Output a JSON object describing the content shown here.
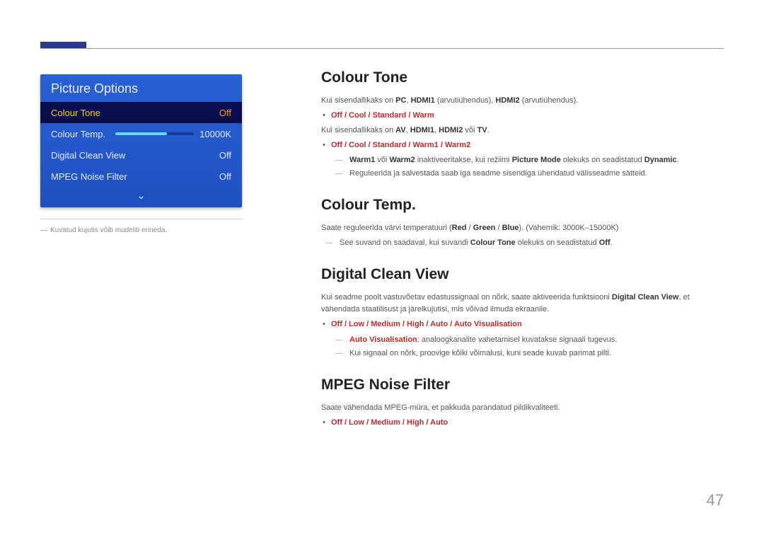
{
  "page_number": "47",
  "osd": {
    "title": "Picture Options",
    "rows": [
      {
        "label": "Colour Tone",
        "value": "Off"
      },
      {
        "label": "Colour Temp.",
        "value": "10000K"
      },
      {
        "label": "Digital Clean View",
        "value": "Off"
      },
      {
        "label": "MPEG Noise Filter",
        "value": "Off"
      }
    ],
    "chevron": "⌄"
  },
  "left_note": "Kuvatud kujutis võib mudeliti erineda.",
  "s1": {
    "h": "Colour Tone",
    "p1a": "Kui sisendallikaks on ",
    "p1b": "PC",
    "p1c": ", ",
    "p1d": "HDMI1",
    "p1e": " (arvutiühendus), ",
    "p1f": "HDMI2",
    "p1g": " (arvutiühendus).",
    "b1": "Off / Cool / Standard / Warm",
    "p2a": "Kui sisendallikaks on ",
    "p2b": "AV",
    "p2c": ", ",
    "p2d": "HDMI1",
    "p2e": ", ",
    "p2f": "HDMI2",
    "p2g": " või ",
    "p2h": "TV",
    "p2i": ".",
    "b2": "Off / Cool / Standard / Warm1 / Warm2",
    "n1a": "Warm1",
    "n1b": " või ",
    "n1c": "Warm2",
    "n1d": " inaktiveeritakse, kui režiimi ",
    "n1e": "Picture Mode",
    "n1f": " olekuks on seadistatud ",
    "n1g": "Dynamic",
    "n1h": ".",
    "n2": "Reguleerida ja salvestada saab iga seadme sisendiga ühendatud välisseadme sätteid."
  },
  "s2": {
    "h": "Colour Temp.",
    "p1a": "Saate reguleerida värvi temperatuuri (",
    "p1b": "Red",
    "p1c": " / ",
    "p1d": "Green",
    "p1e": " / ",
    "p1f": "Blue",
    "p1g": "). (Vahemik: 3000K–15000K)",
    "n1a": "See suvand on saadaval, kui suvandi ",
    "n1b": "Colour Tone",
    "n1c": " olekuks on seadistatud ",
    "n1d": "Off",
    "n1e": "."
  },
  "s3": {
    "h": "Digital Clean View",
    "p1a": "Kui seadme poolt vastuvõetav edastussignaal on nõrk, saate aktiveerida funktsiooni ",
    "p1b": "Digital Clean View",
    "p1c": ", et vähendada staatilisust ja järelkujutisi, mis võivad ilmuda ekraanile.",
    "b1": "Off / Low / Medium / High / Auto / Auto Visualisation",
    "n1a": "Auto Visualisation",
    "n1b": ": analoogkanalite vahetamisel kuvatakse signaali tugevus.",
    "n2": "Kui signaal on nõrk, proovige kõiki võimalusi, kuni seade kuvab parimat pilti."
  },
  "s4": {
    "h": "MPEG Noise Filter",
    "p1": "Saate vähendada MPEG-müra, et pakkuda parandatud pildikvaliteeti.",
    "b1": "Off / Low / Medium / High / Auto"
  }
}
